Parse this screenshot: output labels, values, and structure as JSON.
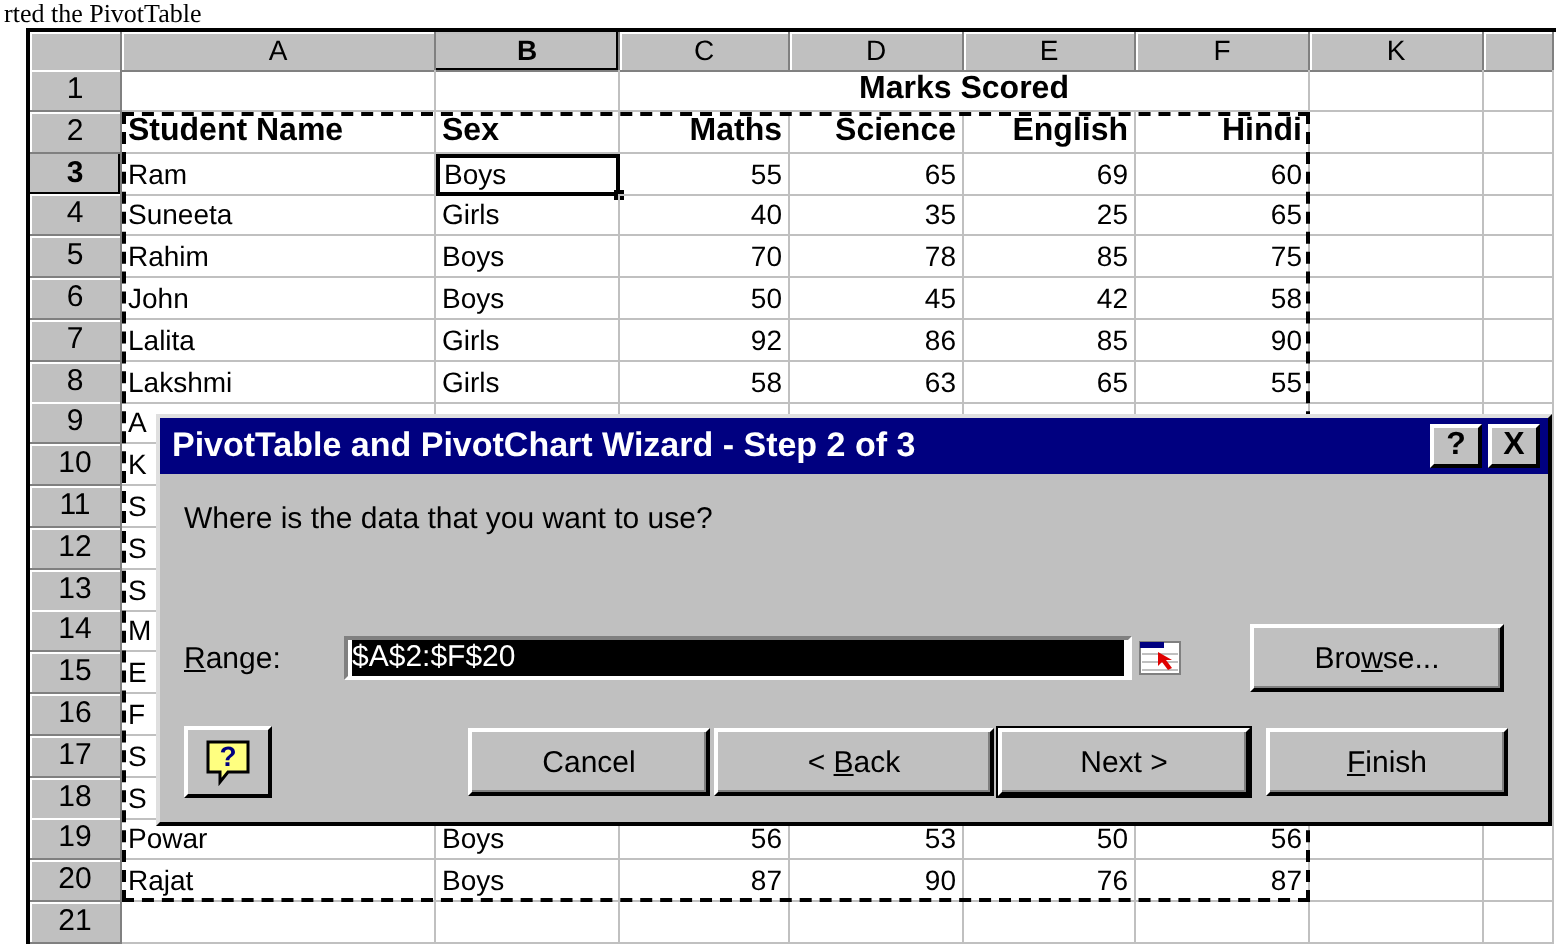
{
  "caption": "rted the PivotTable",
  "sheet": {
    "columns": [
      {
        "label": "A",
        "selected": false
      },
      {
        "label": "B",
        "selected": true
      },
      {
        "label": "C",
        "selected": false
      },
      {
        "label": "D",
        "selected": false
      },
      {
        "label": "E",
        "selected": false
      },
      {
        "label": "F",
        "selected": false
      },
      {
        "label": "K",
        "selected": false
      }
    ],
    "rows": [
      {
        "number": "1",
        "selected": false,
        "kind": "title",
        "title": "Marks Scored"
      },
      {
        "number": "2",
        "selected": false,
        "kind": "header",
        "cells": [
          "Student Name",
          "Sex",
          "Maths",
          "Science",
          "English",
          "Hindi"
        ]
      },
      {
        "number": "3",
        "selected": true,
        "kind": "data",
        "cells": [
          {
            "text": "Ram",
            "selected": false
          },
          {
            "text": "Boys",
            "selected": true
          },
          {
            "text": "55",
            "selected": false
          },
          {
            "text": "65",
            "selected": false
          },
          {
            "text": "69",
            "selected": false
          },
          {
            "text": "60",
            "selected": false
          }
        ]
      },
      {
        "number": "4",
        "selected": false,
        "kind": "data",
        "cells": [
          {
            "text": "Suneeta",
            "selected": false
          },
          {
            "text": "Girls",
            "selected": false
          },
          {
            "text": "40",
            "selected": false
          },
          {
            "text": "35",
            "selected": false
          },
          {
            "text": "25",
            "selected": false
          },
          {
            "text": "65",
            "selected": false
          }
        ]
      },
      {
        "number": "5",
        "selected": false,
        "kind": "data",
        "cells": [
          {
            "text": "Rahim",
            "selected": false
          },
          {
            "text": "Boys",
            "selected": false
          },
          {
            "text": "70",
            "selected": false
          },
          {
            "text": "78",
            "selected": false
          },
          {
            "text": "85",
            "selected": false
          },
          {
            "text": "75",
            "selected": false
          }
        ]
      },
      {
        "number": "6",
        "selected": false,
        "kind": "data",
        "cells": [
          {
            "text": "John",
            "selected": false
          },
          {
            "text": "Boys",
            "selected": false
          },
          {
            "text": "50",
            "selected": false
          },
          {
            "text": "45",
            "selected": false
          },
          {
            "text": "42",
            "selected": false
          },
          {
            "text": "58",
            "selected": false
          }
        ]
      },
      {
        "number": "7",
        "selected": false,
        "kind": "data",
        "cells": [
          {
            "text": "Lalita",
            "selected": false
          },
          {
            "text": "Girls",
            "selected": false
          },
          {
            "text": "92",
            "selected": false
          },
          {
            "text": "86",
            "selected": false
          },
          {
            "text": "85",
            "selected": false
          },
          {
            "text": "90",
            "selected": false
          }
        ]
      },
      {
        "number": "8",
        "selected": false,
        "kind": "data",
        "cells": [
          {
            "text": "Lakshmi",
            "selected": false
          },
          {
            "text": "Girls",
            "selected": false
          },
          {
            "text": "58",
            "selected": false
          },
          {
            "text": "63",
            "selected": false
          },
          {
            "text": "65",
            "selected": false
          },
          {
            "text": "55",
            "selected": false
          }
        ]
      },
      {
        "number": "9",
        "selected": false,
        "kind": "covered",
        "visible_text": "A"
      },
      {
        "number": "10",
        "selected": false,
        "kind": "covered",
        "visible_text": "K"
      },
      {
        "number": "11",
        "selected": false,
        "kind": "covered",
        "visible_text": "S"
      },
      {
        "number": "12",
        "selected": false,
        "kind": "covered",
        "visible_text": "S"
      },
      {
        "number": "13",
        "selected": false,
        "kind": "covered",
        "visible_text": "S"
      },
      {
        "number": "14",
        "selected": false,
        "kind": "covered",
        "visible_text": "M"
      },
      {
        "number": "15",
        "selected": false,
        "kind": "covered",
        "visible_text": "E"
      },
      {
        "number": "16",
        "selected": false,
        "kind": "covered",
        "visible_text": "F"
      },
      {
        "number": "17",
        "selected": false,
        "kind": "covered",
        "visible_text": "S"
      },
      {
        "number": "18",
        "selected": false,
        "kind": "covered",
        "visible_text": "S"
      },
      {
        "number": "19",
        "selected": false,
        "kind": "data",
        "cells": [
          {
            "text": "Powar",
            "selected": false
          },
          {
            "text": "Boys",
            "selected": false
          },
          {
            "text": "56",
            "selected": false
          },
          {
            "text": "53",
            "selected": false
          },
          {
            "text": "50",
            "selected": false
          },
          {
            "text": "56",
            "selected": false
          }
        ]
      },
      {
        "number": "20",
        "selected": false,
        "kind": "data",
        "cells": [
          {
            "text": "Rajat",
            "selected": false
          },
          {
            "text": "Boys",
            "selected": false
          },
          {
            "text": "87",
            "selected": false
          },
          {
            "text": "90",
            "selected": false
          },
          {
            "text": "76",
            "selected": false
          },
          {
            "text": "87",
            "selected": false
          }
        ]
      },
      {
        "number": "21",
        "selected": false,
        "kind": "empty"
      }
    ]
  },
  "dialog": {
    "title": "PivotTable and PivotChart Wizard - Step 2 of 3",
    "title_buttons": [
      "?",
      "X"
    ],
    "prompt": "Where is the data that you want to use?",
    "range_label": {
      "key": "R",
      "after": "ange:"
    },
    "range_value": "$A$2:$F$20",
    "browse_button": {
      "before": "Bro",
      "key": "w",
      "after": "se..."
    },
    "help_glyph": "?",
    "buttons": [
      {
        "before": "Cancel",
        "default": false
      },
      {
        "before": "< ",
        "key": "B",
        "after": "ack",
        "default": false
      },
      {
        "before": "Next >",
        "default": true
      },
      {
        "key": "F",
        "after": "inish",
        "default": false
      }
    ]
  }
}
